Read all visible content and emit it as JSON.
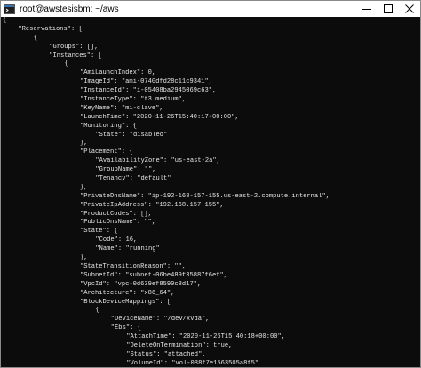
{
  "window": {
    "title": "root@awstesisbm: ~/aws",
    "icon": "terminal-app-icon",
    "controls": [
      "minimize-icon",
      "maximize-icon",
      "close-icon"
    ]
  },
  "terminal": {
    "background": "#0c0c0c",
    "foreground": "#e6e6e6",
    "lines": [
      {
        "indent": 0,
        "text": "{"
      },
      {
        "indent": 1,
        "text": "\"Reservations\": ["
      },
      {
        "indent": 2,
        "text": "{"
      },
      {
        "indent": 3,
        "text": "\"Groups\": [],"
      },
      {
        "indent": 3,
        "text": "\"Instances\": ["
      },
      {
        "indent": 4,
        "text": "{"
      },
      {
        "indent": 5,
        "text": "\"AmiLaunchIndex\": 0,"
      },
      {
        "indent": 5,
        "text": "\"ImageId\": \"ami-0740dfd28c11c9341\","
      },
      {
        "indent": 5,
        "text": "\"InstanceId\": \"i-05408ba2945069c63\","
      },
      {
        "indent": 5,
        "text": "\"InstanceType\": \"t3.medium\","
      },
      {
        "indent": 5,
        "text": "\"KeyName\": \"mi-clave\","
      },
      {
        "indent": 5,
        "text": "\"LaunchTime\": \"2020-11-26T15:40:17+00:00\","
      },
      {
        "indent": 5,
        "text": "\"Monitoring\": {"
      },
      {
        "indent": 6,
        "text": "\"State\": \"disabled\""
      },
      {
        "indent": 5,
        "text": "},"
      },
      {
        "indent": 5,
        "text": "\"Placement\": {"
      },
      {
        "indent": 6,
        "text": "\"AvailabilityZone\": \"us-east-2a\","
      },
      {
        "indent": 6,
        "text": "\"GroupName\": \"\","
      },
      {
        "indent": 6,
        "text": "\"Tenancy\": \"default\""
      },
      {
        "indent": 5,
        "text": "},"
      },
      {
        "indent": 5,
        "text": "\"PrivateDnsName\": \"ip-192-168-157-155.us-east-2.compute.internal\","
      },
      {
        "indent": 5,
        "text": "\"PrivateIpAddress\": \"192.168.157.155\","
      },
      {
        "indent": 5,
        "text": "\"ProductCodes\": [],"
      },
      {
        "indent": 5,
        "text": "\"PublicDnsName\": \"\","
      },
      {
        "indent": 5,
        "text": "\"State\": {"
      },
      {
        "indent": 6,
        "text": "\"Code\": 16,"
      },
      {
        "indent": 6,
        "text": "\"Name\": \"running\""
      },
      {
        "indent": 5,
        "text": "},"
      },
      {
        "indent": 5,
        "text": "\"StateTransitionReason\": \"\","
      },
      {
        "indent": 5,
        "text": "\"SubnetId\": \"subnet-06be489f35887f6ef\","
      },
      {
        "indent": 5,
        "text": "\"VpcId\": \"vpc-0d639ef8590c8d17\","
      },
      {
        "indent": 5,
        "text": "\"Architecture\": \"x86_64\","
      },
      {
        "indent": 5,
        "text": "\"BlockDeviceMappings\": ["
      },
      {
        "indent": 6,
        "text": "{"
      },
      {
        "indent": 7,
        "text": "\"DeviceName\": \"/dev/xvda\","
      },
      {
        "indent": 7,
        "text": "\"Ebs\": {"
      },
      {
        "indent": 8,
        "text": "\"AttachTime\": \"2020-11-26T15:40:18+00:00\","
      },
      {
        "indent": 8,
        "text": "\"DeleteOnTermination\": true,"
      },
      {
        "indent": 8,
        "text": "\"Status\": \"attached\","
      },
      {
        "indent": 8,
        "text": "\"VolumeId\": \"vol-088f7e1563505a8f5\""
      }
    ]
  }
}
